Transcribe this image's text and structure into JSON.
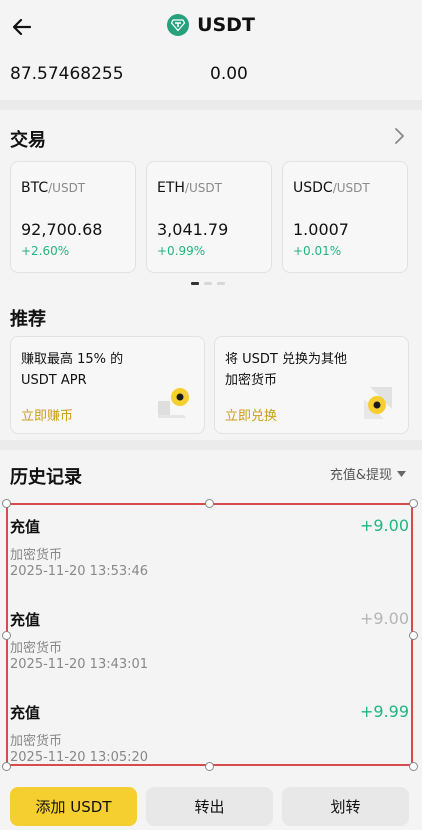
{
  "header": {
    "title": "USDT"
  },
  "balances": [
    {
      "value": "87.57468255"
    },
    {
      "value": "0.00"
    }
  ],
  "trade": {
    "title": "交易",
    "pairs": [
      {
        "base": "BTC",
        "quote": "/USDT",
        "price": "92,700.68",
        "change": "+2.60%"
      },
      {
        "base": "ETH",
        "quote": "/USDT",
        "price": "3,041.79",
        "change": "+0.99%"
      },
      {
        "base": "USDC",
        "quote": "/USDT",
        "price": "1.0007",
        "change": "+0.01%"
      }
    ]
  },
  "recommend": {
    "title": "推荐",
    "items": [
      {
        "line1": "赚取最高 15% 的",
        "line2": "USDT APR",
        "link": "立即赚币"
      },
      {
        "line1": "将 USDT 兑换为其他",
        "line2": "加密货币",
        "link": "立即兑换"
      }
    ]
  },
  "history": {
    "title": "历史记录",
    "filter": "充值&提现",
    "records": [
      {
        "type": "充值",
        "sub": "加密货币",
        "time": "2025-11-20 13:53:46",
        "amount": "+9.00",
        "color": "#22b57f"
      },
      {
        "type": "充值",
        "sub": "加密货币",
        "time": "2025-11-20 13:43:01",
        "amount": "+9.00",
        "color": "#b5b5b5"
      },
      {
        "type": "充值",
        "sub": "加密货币",
        "time": "2025-11-20 13:05:20",
        "amount": "+9.99",
        "color": "#22b57f"
      }
    ]
  },
  "actions": {
    "deposit": "添加 USDT",
    "withdraw": "转出",
    "transfer": "划转"
  },
  "colors": {
    "accent": "#f5cf2f",
    "positive": "#22b57f",
    "tether": "#26a17b",
    "highlight": "#d94a4a"
  }
}
